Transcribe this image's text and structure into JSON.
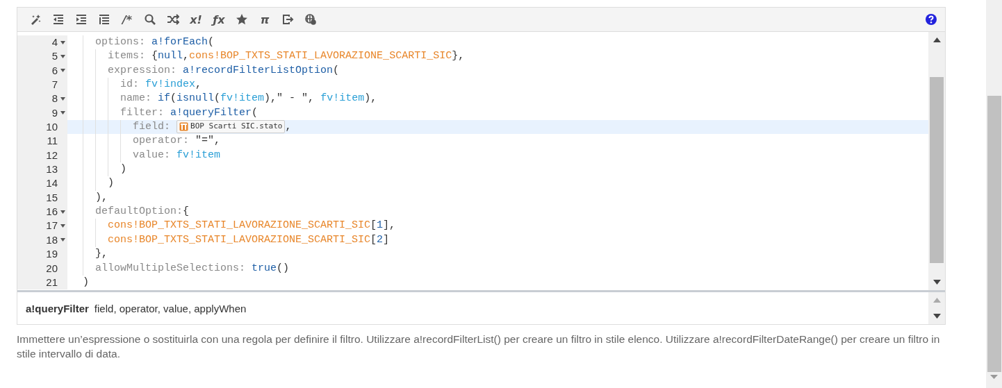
{
  "toolbar": [
    {
      "kind": "icon"
    },
    {
      "kind": "icon"
    },
    {
      "kind": "icon"
    },
    {
      "kind": "icon"
    },
    {
      "kind": "glyph",
      "label": "/*"
    },
    {
      "kind": "icon"
    },
    {
      "kind": "icon"
    },
    {
      "kind": "glyph",
      "label": "x!"
    },
    {
      "kind": "glyph",
      "label": "ƒx"
    },
    {
      "kind": "icon"
    },
    {
      "kind": "glyph",
      "label": "π"
    },
    {
      "kind": "icon"
    },
    {
      "kind": "icon"
    }
  ],
  "editor": {
    "lines": [
      {
        "number": "4",
        "foldable": true,
        "selected": false,
        "tokens": [
          {
            "kind": "key",
            "text": "    options: "
          },
          {
            "kind": "func",
            "text": "a!forEach"
          },
          {
            "kind": "punct",
            "text": "("
          }
        ]
      },
      {
        "number": "5",
        "foldable": true,
        "selected": false,
        "tokens": [
          {
            "kind": "key",
            "text": "      items:"
          },
          {
            "kind": "punct",
            "text": " {"
          },
          {
            "kind": "func",
            "text": "null"
          },
          {
            "kind": "punct",
            "text": ","
          },
          {
            "kind": "const",
            "text": "cons!BOP_TXTS_STATI_LAVORAZIONE_SCARTI_SIC"
          },
          {
            "kind": "punct",
            "text": "},"
          }
        ]
      },
      {
        "number": "6",
        "foldable": true,
        "selected": false,
        "tokens": [
          {
            "kind": "key",
            "text": "      expression: "
          },
          {
            "kind": "func",
            "text": "a!recordFilterListOption"
          },
          {
            "kind": "punct",
            "text": "("
          }
        ]
      },
      {
        "number": "7",
        "foldable": false,
        "selected": false,
        "tokens": [
          {
            "kind": "key",
            "text": "        id: "
          },
          {
            "kind": "var",
            "text": "fv!index"
          },
          {
            "kind": "punct",
            "text": ","
          }
        ]
      },
      {
        "number": "8",
        "foldable": true,
        "selected": false,
        "tokens": [
          {
            "kind": "key",
            "text": "        name: "
          },
          {
            "kind": "func",
            "text": "if"
          },
          {
            "kind": "punct",
            "text": "("
          },
          {
            "kind": "func",
            "text": "isnull"
          },
          {
            "kind": "punct",
            "text": "("
          },
          {
            "kind": "var",
            "text": "fv!item"
          },
          {
            "kind": "punct",
            "text": "),\" - \", "
          },
          {
            "kind": "var",
            "text": "fv!item"
          },
          {
            "kind": "punct",
            "text": "),"
          }
        ]
      },
      {
        "number": "9",
        "foldable": true,
        "selected": false,
        "tokens": [
          {
            "kind": "key",
            "text": "        filter: "
          },
          {
            "kind": "func",
            "text": "a!queryFilter"
          },
          {
            "kind": "punct",
            "text": "("
          }
        ]
      },
      {
        "number": "10",
        "foldable": false,
        "selected": true,
        "tokens": [
          {
            "kind": "key",
            "text": "          field: "
          },
          {
            "kind": "chip",
            "text": "BOP Scarti SIC.stato"
          },
          {
            "kind": "punct",
            "text": ","
          }
        ]
      },
      {
        "number": "11",
        "foldable": false,
        "selected": false,
        "tokens": [
          {
            "kind": "key",
            "text": "          operator:"
          },
          {
            "kind": "punct",
            "text": " \"=\","
          }
        ]
      },
      {
        "number": "12",
        "foldable": false,
        "selected": false,
        "tokens": [
          {
            "kind": "key",
            "text": "          value: "
          },
          {
            "kind": "var",
            "text": "fv!item"
          }
        ]
      },
      {
        "number": "13",
        "foldable": false,
        "selected": false,
        "tokens": [
          {
            "kind": "punct",
            "text": "        )"
          }
        ]
      },
      {
        "number": "14",
        "foldable": false,
        "selected": false,
        "tokens": [
          {
            "kind": "punct",
            "text": "      )"
          }
        ]
      },
      {
        "number": "15",
        "foldable": false,
        "selected": false,
        "tokens": [
          {
            "kind": "punct",
            "text": "    ),"
          }
        ]
      },
      {
        "number": "16",
        "foldable": true,
        "selected": false,
        "tokens": [
          {
            "kind": "key",
            "text": "    defaultOption:"
          },
          {
            "kind": "punct",
            "text": "{"
          }
        ]
      },
      {
        "number": "17",
        "foldable": true,
        "selected": false,
        "tokens": [
          {
            "kind": "const",
            "text": "      cons!BOP_TXTS_STATI_LAVORAZIONE_SCARTI_SIC"
          },
          {
            "kind": "punct",
            "text": "["
          },
          {
            "kind": "num",
            "text": "1"
          },
          {
            "kind": "punct",
            "text": "],"
          }
        ]
      },
      {
        "number": "18",
        "foldable": true,
        "selected": false,
        "tokens": [
          {
            "kind": "const",
            "text": "      cons!BOP_TXTS_STATI_LAVORAZIONE_SCARTI_SIC"
          },
          {
            "kind": "punct",
            "text": "["
          },
          {
            "kind": "num",
            "text": "2"
          },
          {
            "kind": "punct",
            "text": "]"
          }
        ]
      },
      {
        "number": "19",
        "foldable": false,
        "selected": false,
        "tokens": [
          {
            "kind": "punct",
            "text": "    },"
          }
        ]
      },
      {
        "number": "20",
        "foldable": false,
        "selected": false,
        "tokens": [
          {
            "kind": "key",
            "text": "    allowMultipleSelections: "
          },
          {
            "kind": "func",
            "text": "true"
          },
          {
            "kind": "punct",
            "text": "()"
          }
        ]
      },
      {
        "number": "21",
        "foldable": false,
        "selected": false,
        "tokens": [
          {
            "kind": "punct",
            "text": "  )"
          }
        ]
      }
    ]
  },
  "hint": {
    "function": "a!queryFilter",
    "params": "field, operator, value, applyWhen"
  },
  "description": "Immettere un’espressione o sostituirla con una regola per definire il filtro. Utilizzare a!recordFilterList() per creare un filtro in stile elenco. Utilizzare a!recordFilterDateRange() per creare un filtro in stile intervallo di data."
}
